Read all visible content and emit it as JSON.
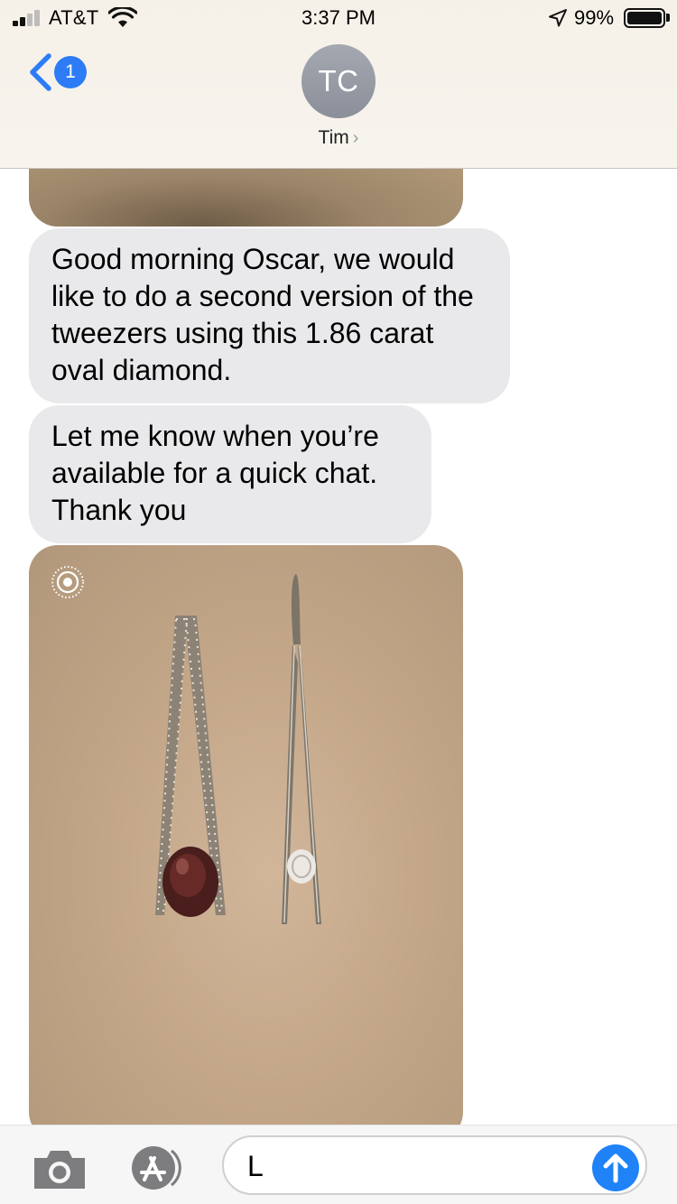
{
  "status_bar": {
    "carrier": "AT&T",
    "time": "3:37 PM",
    "battery_percent": "99%",
    "battery_level": 0.99,
    "signal_bars": 2,
    "signal_bars_total": 4
  },
  "header": {
    "back_badge_count": "1",
    "avatar_initials": "TC",
    "contact_name": "Tim",
    "contact_chevron": "›"
  },
  "messages": [
    {
      "type": "image",
      "description_icon": "photo-attachment"
    },
    {
      "type": "text",
      "text": "Good morning Oscar, we would like to do a second version of the tweezers using this 1.86 carat oval diamond."
    },
    {
      "type": "text",
      "text": "Let me know when you’re available for a quick chat. Thank you"
    },
    {
      "type": "image",
      "live_photo_icon": "live-photo-icon"
    }
  ],
  "input": {
    "value": "L",
    "camera_icon": "camera-icon",
    "apps_icon": "app-store-icon",
    "send_icon": "send-arrow-icon"
  },
  "colors": {
    "accent_blue": "#2d7cf6",
    "bubble_gray": "#e9e9eb",
    "avatar_gray": "#9a9ea7",
    "header_bg": "#f6f1e8"
  }
}
